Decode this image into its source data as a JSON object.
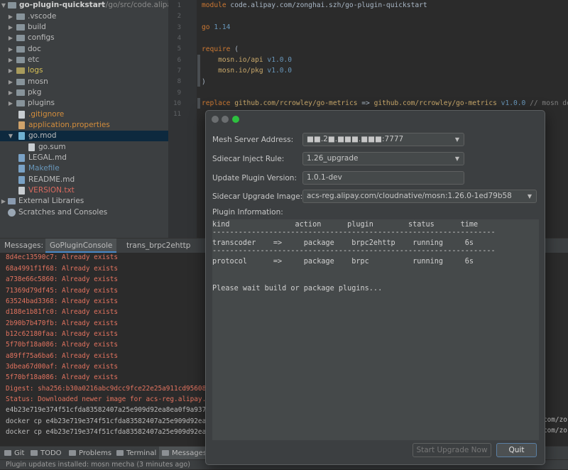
{
  "project": {
    "root_name": "go-plugin-quickstart",
    "root_path": "~/go/src/code.alipay.co",
    "items": [
      {
        "label": ".vscode",
        "kind": "folder"
      },
      {
        "label": "build",
        "kind": "folder"
      },
      {
        "label": "configs",
        "kind": "folder"
      },
      {
        "label": "doc",
        "kind": "folder"
      },
      {
        "label": "etc",
        "kind": "folder"
      },
      {
        "label": "logs",
        "kind": "folder"
      },
      {
        "label": "mosn",
        "kind": "folder"
      },
      {
        "label": "pkg",
        "kind": "folder"
      },
      {
        "label": "plugins",
        "kind": "folder"
      },
      {
        "label": ".gitignore",
        "kind": "file"
      },
      {
        "label": "application.properties",
        "kind": "file"
      },
      {
        "label": "go.mod",
        "kind": "file"
      },
      {
        "label": "go.sum",
        "kind": "file"
      },
      {
        "label": "LEGAL.md",
        "kind": "file"
      },
      {
        "label": "Makefile",
        "kind": "file"
      },
      {
        "label": "README.md",
        "kind": "file"
      },
      {
        "label": "VERSION.txt",
        "kind": "file"
      },
      {
        "label": "External Libraries",
        "kind": "lib"
      },
      {
        "label": "Scratches and Consoles",
        "kind": "scratch"
      }
    ]
  },
  "editor": {
    "line_numbers": [
      "1",
      "2",
      "3",
      "4",
      "5",
      "6",
      "7",
      "8",
      "9",
      "10",
      "11"
    ],
    "l1_kw": "module",
    "l1_rest": " code.alipay.com/zonghai.szh/go-plugin-quickstart",
    "l3_kw": "go",
    "l3_num": " 1.14",
    "l5_kw": "require",
    "l5_rest": " (",
    "l6_mod": "mosn.io/api",
    "l6_ver": " v1.0.0",
    "l7_mod": "mosn.io/pkg",
    "l7_ver": " v1.0.0",
    "l8": ")",
    "l10_kw": "replace",
    "l10_a": " github.com/rcrowley/go-metrics",
    "l10_arrow": " => ",
    "l10_b": "github.com/rcrowley/go-metrics",
    "l10_ver": " v1.0.0",
    "l10_cm": " // mosn dependen"
  },
  "messages": {
    "label": "Messages:",
    "tabs": [
      "GoPluginConsole",
      "trans_brpc2ehttp"
    ]
  },
  "console": {
    "red_lines": [
      "8d4ec13590c7: Already exists",
      "68a4991f1f68: Already exists",
      "a738e66c5860: Already exists",
      "71369d79df45: Already exists",
      "63524bad3368: Already exists",
      "d188e1b81fc0: Already exists",
      "2b90b7b470fb: Already exists",
      "b12c62180faa: Already exists",
      "5f70bf18a086: Already exists",
      "a89ff75a6ba6: Already exists",
      "3dbea67d00af: Already exists",
      "5f70bf18a086: Already exists",
      "Digest: sha256:b30a0216abc9dcc9fce22e25a911cd956087e",
      "Status: Downloaded newer image for acs-reg.alipay.co"
    ],
    "gray_lines": [
      "e4b23e719e374f51cfda83582407a25e909d92ea8ea0f9a9371b",
      "docker cp e4b23e719e374f51cfda83582407a25e909d92ea8e",
      "docker cp e4b23e719e374f51cfda83582407a25e909d92ea8e"
    ],
    "right_tails": [
      "com/zo",
      "com/zo"
    ]
  },
  "toolwindows": [
    {
      "label": "Git"
    },
    {
      "label": "TODO"
    },
    {
      "label": "Problems"
    },
    {
      "label": "Terminal"
    },
    {
      "label": "Messages"
    }
  ],
  "status": {
    "text": "Plugin updates installed: mosn mecha (3 minutes ago)"
  },
  "dialog": {
    "mesh_label": "Mesh Server Address:",
    "mesh_value": "■■.2■.■■■.■■■:7777",
    "inject_label": "Sdiecar Inject Rule:",
    "inject_value": "1.26_upgrade",
    "version_label": "Update Plugin Version:",
    "version_value": "1.0.1-dev",
    "image_label": "Sidecar Upgrade Image:",
    "image_value": "acs-reg.alipay.com/cloudnative/mosn:1.26.0-1ed79b58",
    "info_label": "Plugin Information:",
    "info_lines": [
      "kind               action      plugin        status      time",
      "-----------------------------------------------------------------",
      "transcoder    =>     package    brpc2ehttp    running     6s",
      "-----------------------------------------------------------------",
      "protocol      =>     package    brpc          running     6s",
      "Please wait build or package plugins..."
    ],
    "upgrade_button": "Start Upgrade Now",
    "quit_button": "Quit"
  }
}
